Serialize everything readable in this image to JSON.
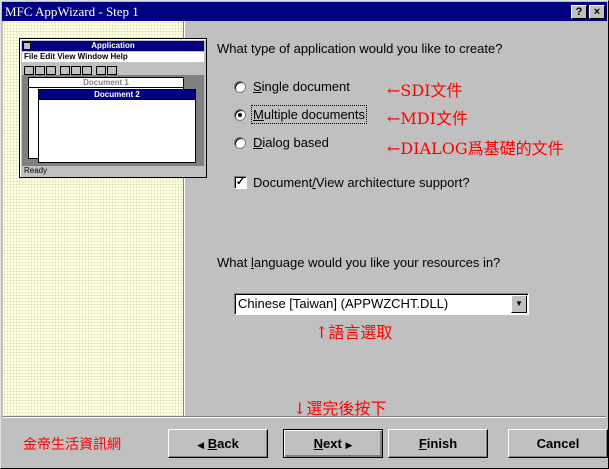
{
  "window": {
    "title": "MFC AppWizard - Step 1",
    "help_button": "?",
    "close_button": "×"
  },
  "illustration": {
    "app_title": "Application",
    "menu": "File  Edit  View  Window  Help",
    "doc1_title": "Document 1",
    "doc2_title": "Document 2",
    "status": "Ready"
  },
  "question1": "What type of application would you like to create?",
  "app_types": [
    {
      "key": "S",
      "rest": "ingle document",
      "selected": false
    },
    {
      "key": "M",
      "rest": "ultiple documents",
      "selected": true
    },
    {
      "key": "D",
      "rest": "ialog based",
      "selected": false
    }
  ],
  "annotations": {
    "sdi": "←SDI文件",
    "mdi": "←MDI文件",
    "dialog": "←DIALOG爲基礎的文件",
    "language": "↑語言選取",
    "finish": "↓選完後按下",
    "watermark": "金帝生活資訊網"
  },
  "docview": {
    "pre": "Document",
    "key": "/",
    "post": "View architecture support?",
    "checked": true
  },
  "question2": {
    "pre": "What ",
    "key": "l",
    "post": "anguage would you like your resources in?"
  },
  "language_select": {
    "value": "Chinese [Taiwan] (APPWZCHT.DLL)"
  },
  "buttons": {
    "back_key": "B",
    "back_rest": "ack",
    "next_key": "N",
    "next_rest": "ext",
    "finish_key": "F",
    "finish_rest": "inish",
    "cancel": "Cancel"
  }
}
